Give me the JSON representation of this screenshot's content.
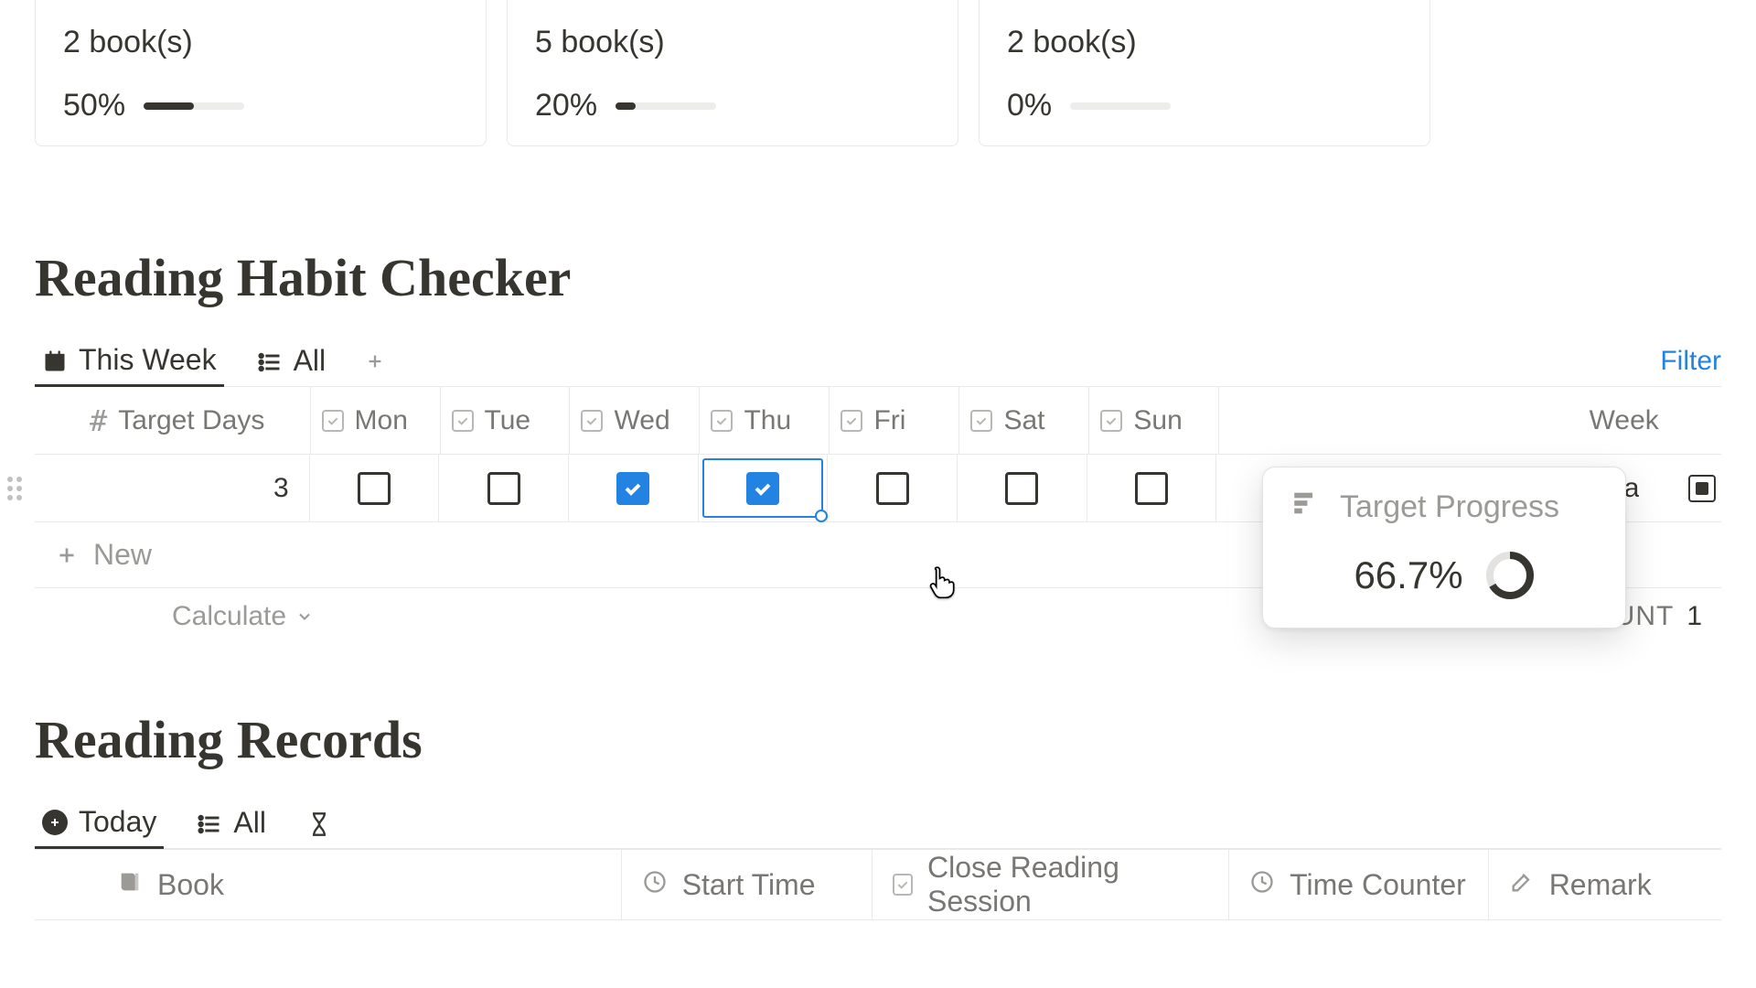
{
  "cards": [
    {
      "books_label": "2 book(s)",
      "percent_label": "50%",
      "percent": 50
    },
    {
      "books_label": "5 book(s)",
      "percent_label": "20%",
      "percent": 20
    },
    {
      "books_label": "2 book(s)",
      "percent_label": "0%",
      "percent": 0
    }
  ],
  "habit": {
    "title": "Reading Habit Checker",
    "tabs": {
      "this_week": "This Week",
      "all": "All"
    },
    "filter_label": "Filter",
    "columns": {
      "target_days": "Target Days",
      "mon": "Mon",
      "tue": "Tue",
      "wed": "Wed",
      "thu": "Thu",
      "fri": "Fri",
      "sat": "Sat",
      "sun": "Sun",
      "week_partial": "Week",
      "target_progress": "Target Progress"
    },
    "row": {
      "target_days_value": "3",
      "mon": false,
      "tue": false,
      "wed": true,
      "thu": true,
      "fri": false,
      "sat": false,
      "sun": false,
      "week_text_partial": "onda"
    },
    "popover": {
      "title": "Target Progress",
      "value": "66.7%",
      "ratio": 0.667
    },
    "new_label": "New",
    "calculate_label": "Calculate",
    "count_label": "COUNT",
    "count_value": "1"
  },
  "records": {
    "title": "Reading Records",
    "tabs": {
      "today": "Today",
      "all": "All"
    },
    "columns": {
      "book": "Book",
      "start": "Start Time",
      "close": "Close Reading Session",
      "time": "Time Counter",
      "remark": "Remark"
    }
  }
}
